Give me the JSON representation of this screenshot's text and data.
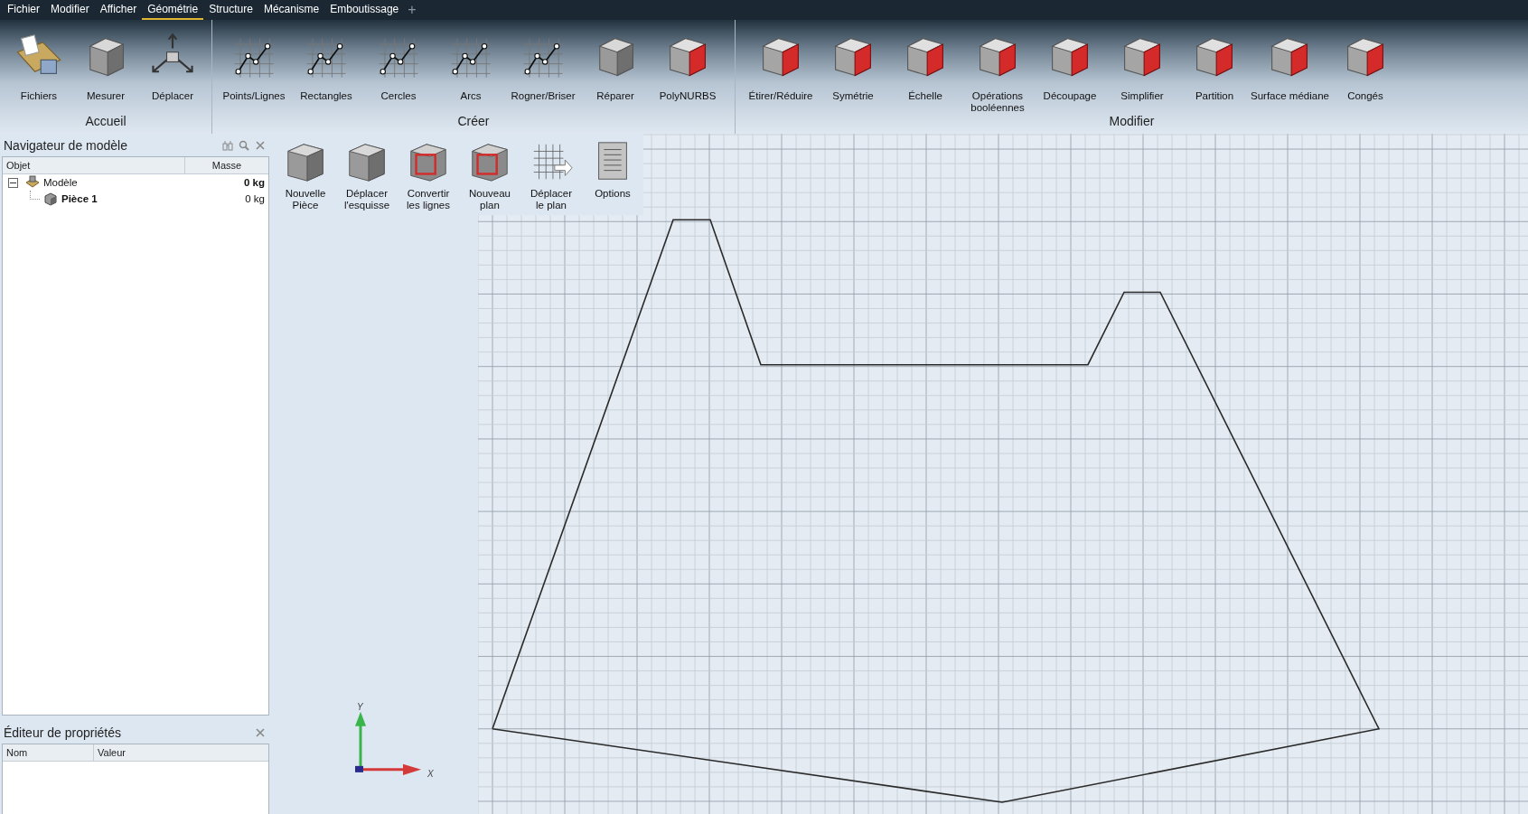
{
  "menu": [
    {
      "label": "Fichier",
      "selected": false
    },
    {
      "label": "Modifier",
      "selected": false
    },
    {
      "label": "Afficher",
      "selected": false
    },
    {
      "label": "Géométrie",
      "selected": true
    },
    {
      "label": "Structure",
      "selected": false
    },
    {
      "label": "Mécanisme",
      "selected": false
    },
    {
      "label": "Emboutissage",
      "selected": false
    }
  ],
  "menu_add": "+",
  "ribbon": [
    {
      "name": "Accueil",
      "buttons": [
        {
          "label": "Fichiers"
        },
        {
          "label": "Mesurer"
        },
        {
          "label": "Déplacer"
        }
      ]
    },
    {
      "name": "Créer",
      "buttons": [
        {
          "label": "Points/Lignes"
        },
        {
          "label": "Rectangles"
        },
        {
          "label": "Cercles"
        },
        {
          "label": "Arcs"
        },
        {
          "label": "Rogner/Briser"
        },
        {
          "label": "Réparer"
        },
        {
          "label": "PolyNURBS"
        }
      ]
    },
    {
      "name": "Modifier",
      "buttons": [
        {
          "label": "Étirer/Réduire"
        },
        {
          "label": "Symétrie"
        },
        {
          "label": "Échelle"
        },
        {
          "label": "Opérations\nbooléennes"
        },
        {
          "label": "Découpage"
        },
        {
          "label": "Simplifier"
        },
        {
          "label": "Partition"
        },
        {
          "label": "Surface médiane"
        },
        {
          "label": "Congés"
        }
      ]
    }
  ],
  "navigator": {
    "title": "Navigateur de modèle",
    "columns": [
      "Objet",
      "Masse"
    ],
    "tree": [
      {
        "name": "Modèle",
        "mass": "0 kg",
        "expanded": true,
        "children": [
          {
            "name": "Pièce 1",
            "mass": "0 kg"
          }
        ]
      }
    ]
  },
  "properties": {
    "title": "Éditeur de propriétés",
    "columns": [
      "Nom",
      "Valeur"
    ]
  },
  "sketch_toolbar": [
    {
      "label": "Nouvelle\nPièce"
    },
    {
      "label": "Déplacer\nl'esquisse"
    },
    {
      "label": "Convertir\nles lignes"
    },
    {
      "label": "Nouveau\nplan"
    },
    {
      "label": "Déplacer\nle plan"
    },
    {
      "label": "Options"
    }
  ],
  "axes": {
    "y": "Y",
    "x": "X"
  }
}
